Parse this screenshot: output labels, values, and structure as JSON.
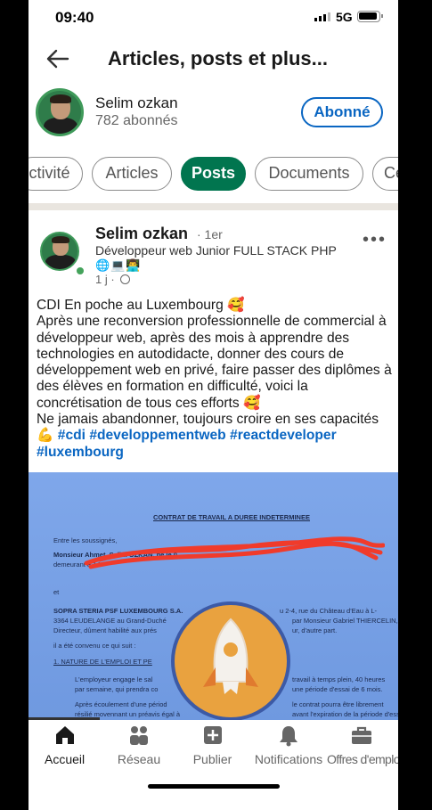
{
  "status_bar": {
    "time": "09:40",
    "network": "5G"
  },
  "header": {
    "title": "Articles, posts et plus..."
  },
  "profile": {
    "name": "Selim ozkan",
    "followers": "782 abonnés",
    "follow_button": "Abonné"
  },
  "tabs": [
    {
      "label": "ctivité",
      "active": false
    },
    {
      "label": "Articles",
      "active": false
    },
    {
      "label": "Posts",
      "active": true
    },
    {
      "label": "Documents",
      "active": false
    },
    {
      "label": "Ce",
      "active": false
    }
  ],
  "post": {
    "author": "Selim ozkan",
    "degree": "· 1er",
    "headline": "Développeur web Junior FULL STACK PHP",
    "headline_emojis": "🌐💻👨‍💻",
    "time": "1 j ·",
    "text_lines": [
      "CDI En poche au Luxembourg 🥰",
      "Après une reconversion professionnelle de commercial à développeur web, après des mois à apprendre des technologies en autodidacte, donner des cours de développement web en privé, faire passer des diplômes à des élèves en formation en difficulté, voici la concrétisation de tous ces efforts 🥰",
      "Ne jamais abandonner, toujours croire en ses capacités"
    ],
    "hashtag_line_emoji": "💪",
    "hashtags": [
      "#cdi",
      "#developpementweb",
      "#reactdeveloper",
      "#luxembourg"
    ],
    "document": {
      "heading": "CONTRAT DE TRAVAIL A DUREE INDETERMINEE",
      "lines": [
        "Entre les soussignés,",
        "Monsieur Ahmet, Selim OZKAN, né le 0",
        "demeurant à 14",
        "et",
        "SOPRA STERIA PSF LUXEMBOURG S.A.",
        "3364 LEUDELANGE au Grand-Duché",
        "Directeur, dûment habilité aux prés",
        "il a été convenu ce qui suit :",
        "1.     NATURE DE L'EMPLOI ET PE",
        "L'employeur engage le sal",
        "par semaine, qui prendra co",
        "Après écoulement d'une périod",
        "résilié movennant un préavis égal à"
      ],
      "right_lines": [
        "u 2-4, rue du Château d'Eau à L-",
        "par Monsieur Gabriel THIERCELIN,",
        "ur, d'autre part.",
        "travail à temps plein, 40 heures",
        "une période d'essai de 6 mois.",
        "le contrat pourra être librement",
        "avant l'expiration de la période d'essai"
      ]
    }
  },
  "bottom_nav": [
    {
      "label": "Accueil",
      "icon": "home-icon",
      "active": true
    },
    {
      "label": "Réseau",
      "icon": "network-icon",
      "active": false
    },
    {
      "label": "Publier",
      "icon": "post-plus-icon",
      "active": false
    },
    {
      "label": "Notifications",
      "icon": "bell-icon",
      "active": false
    },
    {
      "label": "Offres d'emploi",
      "icon": "briefcase-icon",
      "active": false
    }
  ],
  "colors": {
    "accent": "#0a66c2",
    "active_tab": "#01754f",
    "separator": "#e9e5df",
    "badge": "#e9a23f"
  }
}
